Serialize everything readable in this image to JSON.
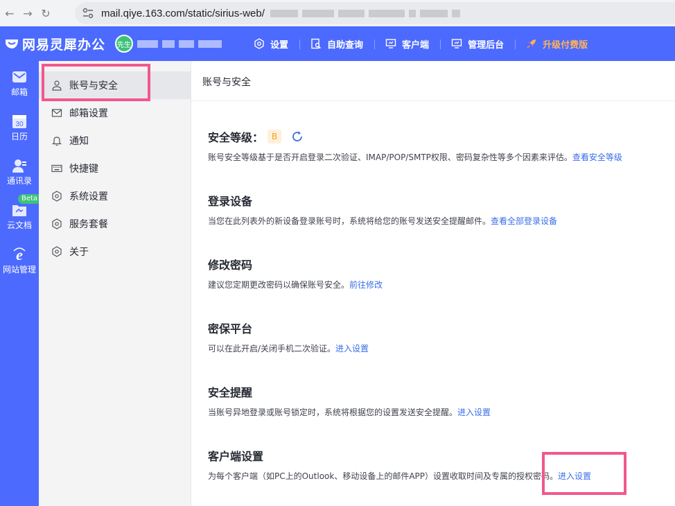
{
  "browser": {
    "url": "mail.qiye.163.com/static/sirius-web/"
  },
  "app": {
    "logo_text": "网易灵犀办公",
    "avatar_text": "先生",
    "top_menu": [
      {
        "label": "设置",
        "icon": "gear-icon"
      },
      {
        "label": "自助查询",
        "icon": "search-doc-icon"
      },
      {
        "label": "客户端",
        "icon": "monitor-icon"
      },
      {
        "label": "管理后台",
        "icon": "monitor-icon"
      },
      {
        "label": "升级付费版",
        "icon": "rocket-icon"
      }
    ],
    "upgrade_color": "#ffb359",
    "brand_color": "#4c6afe"
  },
  "rail": [
    {
      "label": "邮箱",
      "icon": "mail-icon"
    },
    {
      "label": "日历",
      "icon": "calendar-icon",
      "icon_text": "30"
    },
    {
      "label": "通讯录",
      "icon": "contacts-icon"
    },
    {
      "label": "云文档",
      "icon": "cloud-doc-icon",
      "badge": "Beta"
    },
    {
      "label": "网站管理",
      "icon": "ie-icon"
    }
  ],
  "subnav": [
    {
      "label": "账号与安全",
      "icon": "user-icon"
    },
    {
      "label": "邮箱设置",
      "icon": "envelope-icon"
    },
    {
      "label": "通知",
      "icon": "bell-icon"
    },
    {
      "label": "快捷键",
      "icon": "keyboard-icon"
    },
    {
      "label": "系统设置",
      "icon": "hexagon-gear-icon"
    },
    {
      "label": "服务套餐",
      "icon": "hexagon-gear-icon"
    },
    {
      "label": "关于",
      "icon": "hexagon-gear-icon"
    }
  ],
  "main": {
    "header": "账号与安全",
    "sections": [
      {
        "title": "安全等级：",
        "grade": "B",
        "desc": "账号安全等级基于是否开启登录二次验证、IMAP/POP/SMTP权限、密码复杂性等多个因素来评估。",
        "link": "查看安全等级"
      },
      {
        "title": "登录设备",
        "desc": "当您在此列表外的新设备登录账号时，系统将给您的账号发送安全提醒邮件。",
        "link": "查看全部登录设备"
      },
      {
        "title": "修改密码",
        "desc": "建议您定期更改密码以确保账号安全。",
        "link": "前往修改"
      },
      {
        "title": "密保平台",
        "desc": "可以在此开启/关闭手机二次验证。",
        "link": "进入设置"
      },
      {
        "title": "安全提醒",
        "desc": "当账号异地登录或账号锁定时，系统将根据您的设置发送安全提醒。",
        "link": "进入设置"
      },
      {
        "title": "客户端设置",
        "desc": "为每个客户端（如PC上的Outlook、移动设备上的邮件APP）设置收取时间及专属的授权密码。",
        "link": "进入设置"
      }
    ]
  },
  "highlight_color": "#f2578e"
}
